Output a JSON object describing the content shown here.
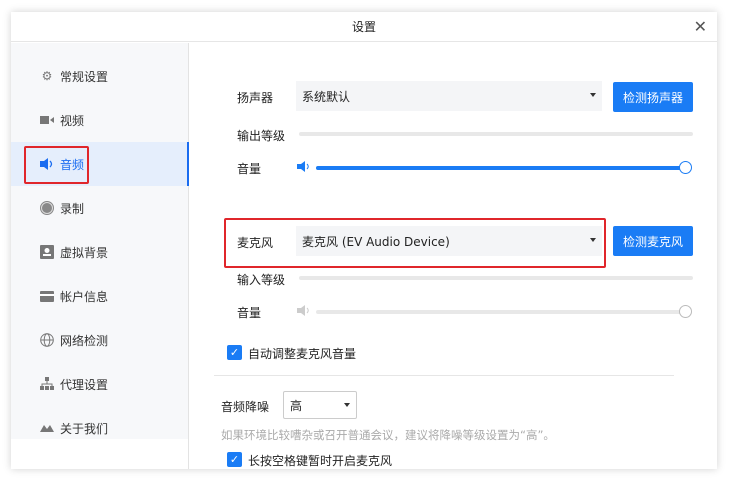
{
  "window": {
    "title": "设置",
    "close": "✕"
  },
  "sidebar": {
    "items": [
      {
        "label": "常规设置",
        "icon": "gear-icon"
      },
      {
        "label": "视频",
        "icon": "camera-icon"
      },
      {
        "label": "音频",
        "icon": "speaker-icon",
        "active": true
      },
      {
        "label": "录制",
        "icon": "record-icon"
      },
      {
        "label": "虚拟背景",
        "icon": "portrait-icon"
      },
      {
        "label": "帐户信息",
        "icon": "card-icon"
      },
      {
        "label": "网络检测",
        "icon": "globe-icon"
      },
      {
        "label": "代理设置",
        "icon": "network-icon"
      },
      {
        "label": "关于我们",
        "icon": "logo-icon"
      }
    ]
  },
  "speaker": {
    "label": "扬声器",
    "device": "系统默认",
    "test_button": "检测扬声器",
    "output_level_label": "输出等级",
    "output_level": 0,
    "volume_label": "音量",
    "volume": 1.0
  },
  "mic": {
    "label": "麦克风",
    "device": "麦克风 (EV Audio Device)",
    "test_button": "检测麦克风",
    "input_level_label": "输入等级",
    "input_level": 0,
    "volume_label": "音量",
    "volume": 1.0
  },
  "auto_adjust": {
    "label": "自动调整麦克风音量",
    "checked": true
  },
  "noise": {
    "label": "音频降噪",
    "value": "高",
    "hint": "如果环境比较嘈杂或召开普通会议，建议将降噪等级设置为“高”。"
  },
  "push_to_talk": {
    "label": "长按空格键暂时开启麦克风",
    "checked": true
  }
}
